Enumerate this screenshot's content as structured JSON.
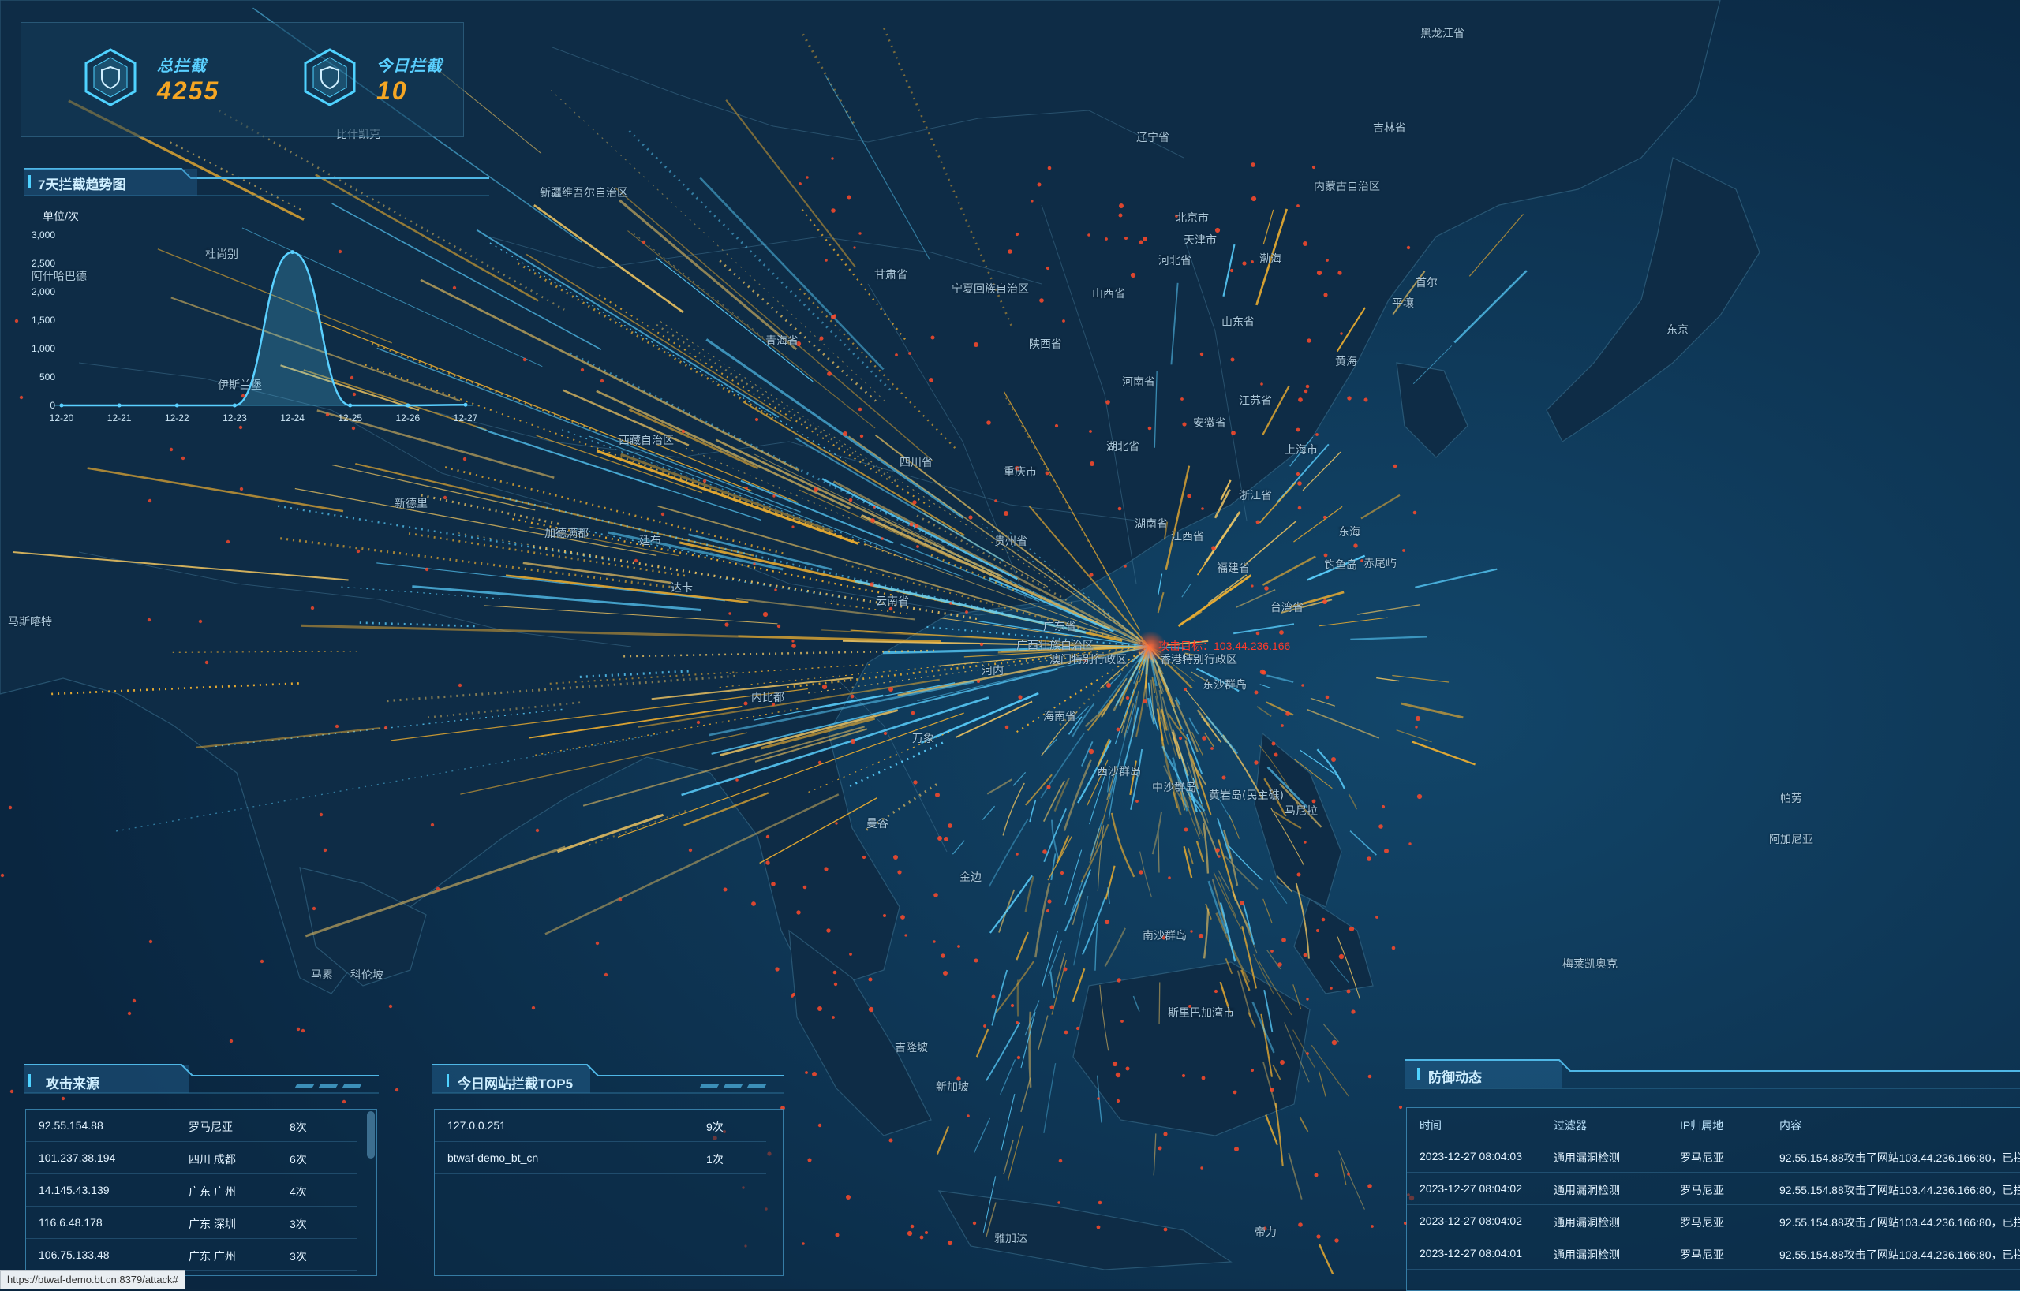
{
  "stats": {
    "total_label": "总拦截",
    "total_value": "4255",
    "today_label": "今日拦截",
    "today_value": "10"
  },
  "trend": {
    "title": "7天拦截趋势图"
  },
  "chart_data": {
    "type": "area",
    "title": "7天拦截趋势图",
    "ylabel": "单位/次",
    "categories": [
      "12-20",
      "12-21",
      "12-22",
      "12-23",
      "12-24",
      "12-25",
      "12-26",
      "12-27"
    ],
    "values": [
      0,
      0,
      0,
      0,
      2700,
      0,
      0,
      10
    ],
    "ylim": [
      0,
      3000
    ],
    "yticks": [
      "0",
      "500",
      "1,000",
      "1,500",
      "2,000",
      "2,500",
      "3,000"
    ],
    "color": "#5ad0ff"
  },
  "map": {
    "target_label": "攻击目标：103.44.236.166",
    "regions": [
      {
        "name": "黑龙江省"
      },
      {
        "name": "吉林省"
      },
      {
        "name": "辽宁省"
      },
      {
        "name": "内蒙古自治区"
      },
      {
        "name": "北京市"
      },
      {
        "name": "天津市"
      },
      {
        "name": "河北省"
      },
      {
        "name": "山西省"
      },
      {
        "name": "山东省"
      },
      {
        "name": "河南省"
      },
      {
        "name": "江苏省"
      },
      {
        "name": "安徽省"
      },
      {
        "name": "上海市"
      },
      {
        "name": "浙江省"
      },
      {
        "name": "湖北省"
      },
      {
        "name": "湖南省"
      },
      {
        "name": "江西省"
      },
      {
        "name": "福建省"
      },
      {
        "name": "台湾省"
      },
      {
        "name": "广东省"
      },
      {
        "name": "广西壮族自治区"
      },
      {
        "name": "海南省"
      },
      {
        "name": "重庆市"
      },
      {
        "name": "四川省"
      },
      {
        "name": "贵州省"
      },
      {
        "name": "云南省"
      },
      {
        "name": "西藏自治区"
      },
      {
        "name": "新疆维吾尔自治区"
      },
      {
        "name": "青海省"
      },
      {
        "name": "甘肃省"
      },
      {
        "name": "宁夏回族自治区"
      },
      {
        "name": "陕西省"
      },
      {
        "name": "香港特别行政区"
      },
      {
        "name": "澳门特别行政区"
      },
      {
        "name": "平壤"
      },
      {
        "name": "首尔"
      },
      {
        "name": "东京"
      },
      {
        "name": "渤海"
      },
      {
        "name": "黄海"
      },
      {
        "name": "东海"
      },
      {
        "name": "钓鱼岛"
      },
      {
        "name": "赤尾屿"
      },
      {
        "name": "东沙群岛"
      },
      {
        "name": "中沙群岛"
      },
      {
        "name": "西沙群岛"
      },
      {
        "name": "南沙群岛"
      },
      {
        "name": "黄岩岛(民主礁)"
      },
      {
        "name": "马尼拉"
      },
      {
        "name": "河内"
      },
      {
        "name": "万象"
      },
      {
        "name": "内比都"
      },
      {
        "name": "曼谷"
      },
      {
        "name": "金边"
      },
      {
        "name": "吉隆坡"
      },
      {
        "name": "新加坡"
      },
      {
        "name": "斯里巴加湾市"
      },
      {
        "name": "雅加达"
      },
      {
        "name": "帝力"
      },
      {
        "name": "新德里"
      },
      {
        "name": "加德满都"
      },
      {
        "name": "廷布"
      },
      {
        "name": "达卡"
      },
      {
        "name": "比什凯克"
      },
      {
        "name": "杜尚别"
      },
      {
        "name": "伊斯兰堡"
      },
      {
        "name": "阿什哈巴德"
      },
      {
        "name": "马斯喀特"
      },
      {
        "name": "马累"
      },
      {
        "name": "科伦坡"
      },
      {
        "name": "帕劳"
      },
      {
        "name": "阿加尼亚"
      },
      {
        "name": "梅莱凯奥克"
      }
    ]
  },
  "source_panel": {
    "title": "攻击来源",
    "rows": [
      {
        "ip": "92.55.154.88",
        "loc": "罗马尼亚",
        "count": "8次"
      },
      {
        "ip": "101.237.38.194",
        "loc": "四川 成都",
        "count": "6次"
      },
      {
        "ip": "14.145.43.139",
        "loc": "广东 广州",
        "count": "4次"
      },
      {
        "ip": "116.6.48.178",
        "loc": "广东 深圳",
        "count": "3次"
      },
      {
        "ip": "106.75.133.48",
        "loc": "广东 广州",
        "count": "3次"
      }
    ]
  },
  "top5_panel": {
    "title": "今日网站拦截TOP5",
    "rows": [
      {
        "site": "127.0.0.251",
        "count": "9次"
      },
      {
        "site": "btwaf-demo_bt_cn",
        "count": "1次"
      }
    ]
  },
  "defense_panel": {
    "title": "防御动态",
    "headers": {
      "time": "时间",
      "filter": "过滤器",
      "ip": "IP归属地",
      "content": "内容"
    },
    "rows": [
      {
        "time": "2023-12-27 08:04:03",
        "filter": "通用漏洞检测",
        "ip": "罗马尼亚",
        "content": "92.55.154.88攻击了网站103.44.236.166:80，已拦"
      },
      {
        "time": "2023-12-27 08:04:02",
        "filter": "通用漏洞检测",
        "ip": "罗马尼亚",
        "content": "92.55.154.88攻击了网站103.44.236.166:80，已拦"
      },
      {
        "time": "2023-12-27 08:04:02",
        "filter": "通用漏洞检测",
        "ip": "罗马尼亚",
        "content": "92.55.154.88攻击了网站103.44.236.166:80，已拦"
      },
      {
        "time": "2023-12-27 08:04:01",
        "filter": "通用漏洞检测",
        "ip": "罗马尼亚",
        "content": "92.55.154.88攻击了网站103.44.236.166:80，已拦"
      }
    ]
  },
  "statusbar": {
    "url": "https://btwaf-demo.bt.cn:8379/attack#"
  },
  "colors": {
    "accent": "#4fd2ff",
    "value": "#f5a623",
    "line_orange": "#f0b030",
    "line_cyan": "#5ad0ff",
    "dot": "#ff4a2a"
  }
}
